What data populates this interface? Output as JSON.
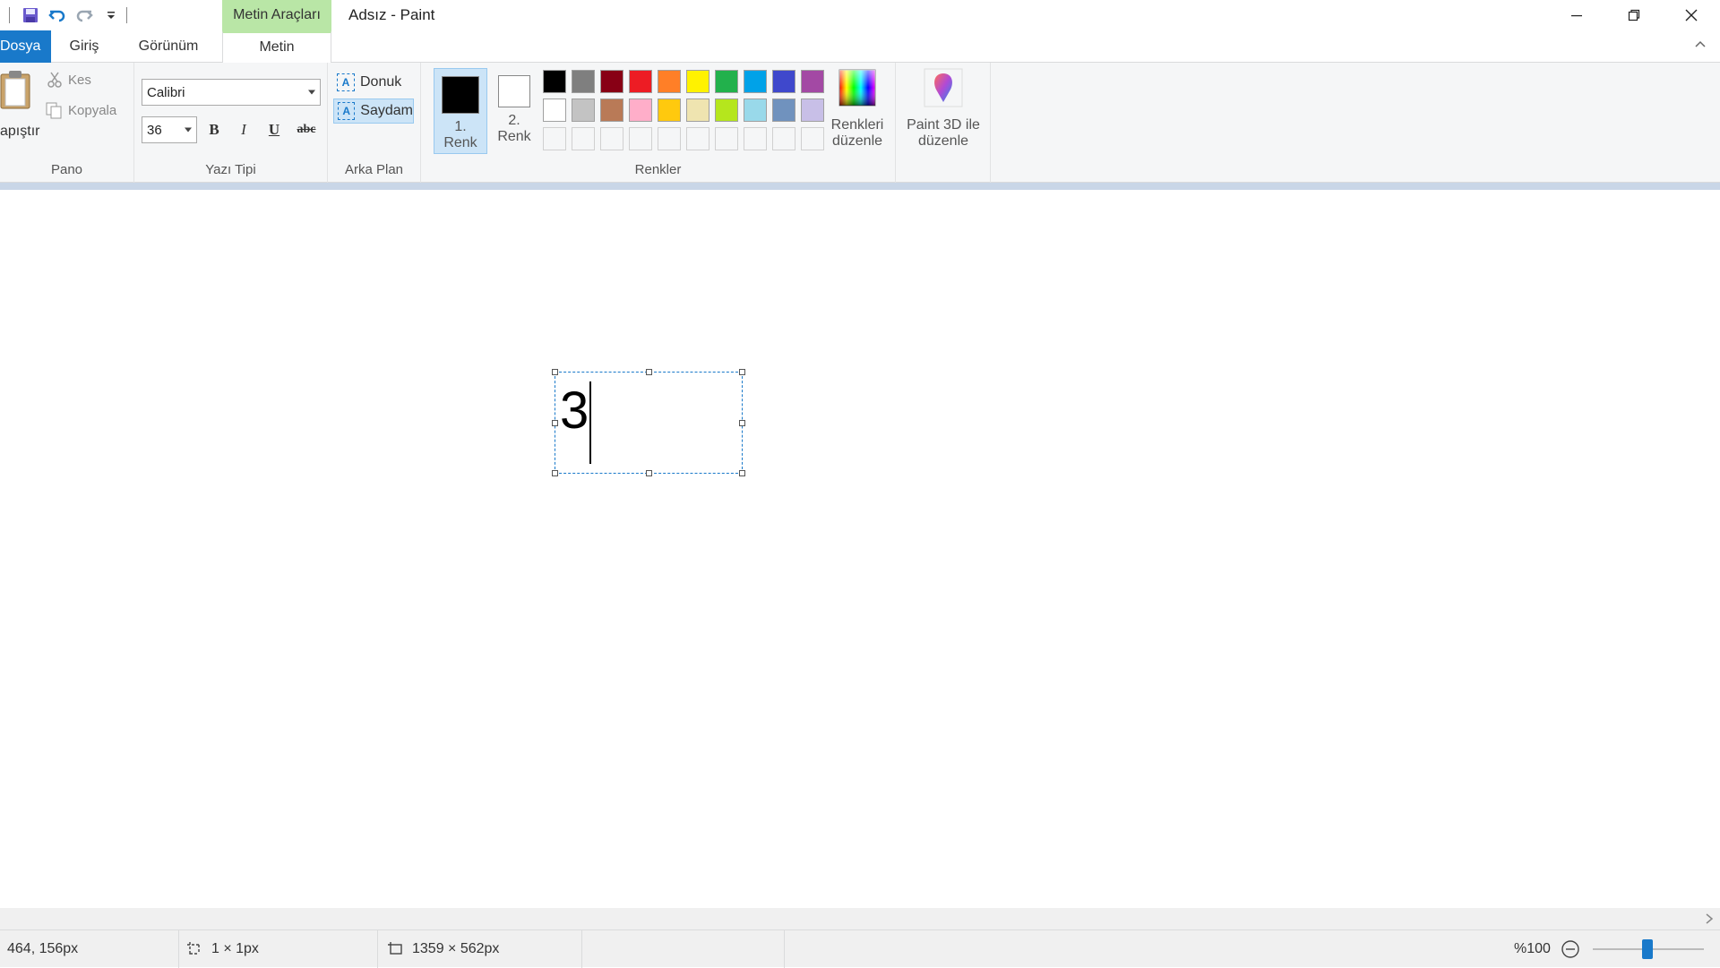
{
  "window": {
    "title": "Adsız - Paint",
    "context_tab_group": "Metin Araçları"
  },
  "tabs": [
    {
      "label": "Dosya"
    },
    {
      "label": "Giriş"
    },
    {
      "label": "Görünüm"
    },
    {
      "label": "Metin"
    }
  ],
  "clipboard": {
    "paste_label": "apıştır",
    "cut_label": "Kes",
    "copy_label": "Kopyala",
    "group_label": "Pano"
  },
  "font": {
    "family": "Calibri",
    "size": "36",
    "group_label": "Yazı Tipi"
  },
  "background": {
    "opaque_label": "Donuk",
    "transparent_label": "Saydam",
    "group_label": "Arka Plan"
  },
  "colors": {
    "color1_label_line1": "1.",
    "color1_label_line2": "Renk",
    "color2_label_line1": "2.",
    "color2_label_line2": "Renk",
    "color1_value": "#000000",
    "color2_value": "#ffffff",
    "edit_colors_line1": "Renkleri",
    "edit_colors_line2": "düzenle",
    "group_label": "Renkler",
    "palette_row1": [
      "#000000",
      "#7f7f7f",
      "#880015",
      "#ed1c24",
      "#ff7f27",
      "#fff200",
      "#22b14c",
      "#00a2e8",
      "#3f48cc",
      "#a349a4"
    ],
    "palette_row2": [
      "#ffffff",
      "#c3c3c3",
      "#b97a57",
      "#ffaec9",
      "#ffc90e",
      "#efe4b0",
      "#b5e61d",
      "#99d9ea",
      "#7092be",
      "#c8bfe7"
    ]
  },
  "paint3d": {
    "line1": "Paint 3D ile",
    "line2": "düzenle"
  },
  "canvas": {
    "text_content": "3"
  },
  "status": {
    "cursor_position": "464, 156px",
    "selection_size": "1 × 1px",
    "image_size": "1359 × 562px",
    "zoom": "%100"
  }
}
